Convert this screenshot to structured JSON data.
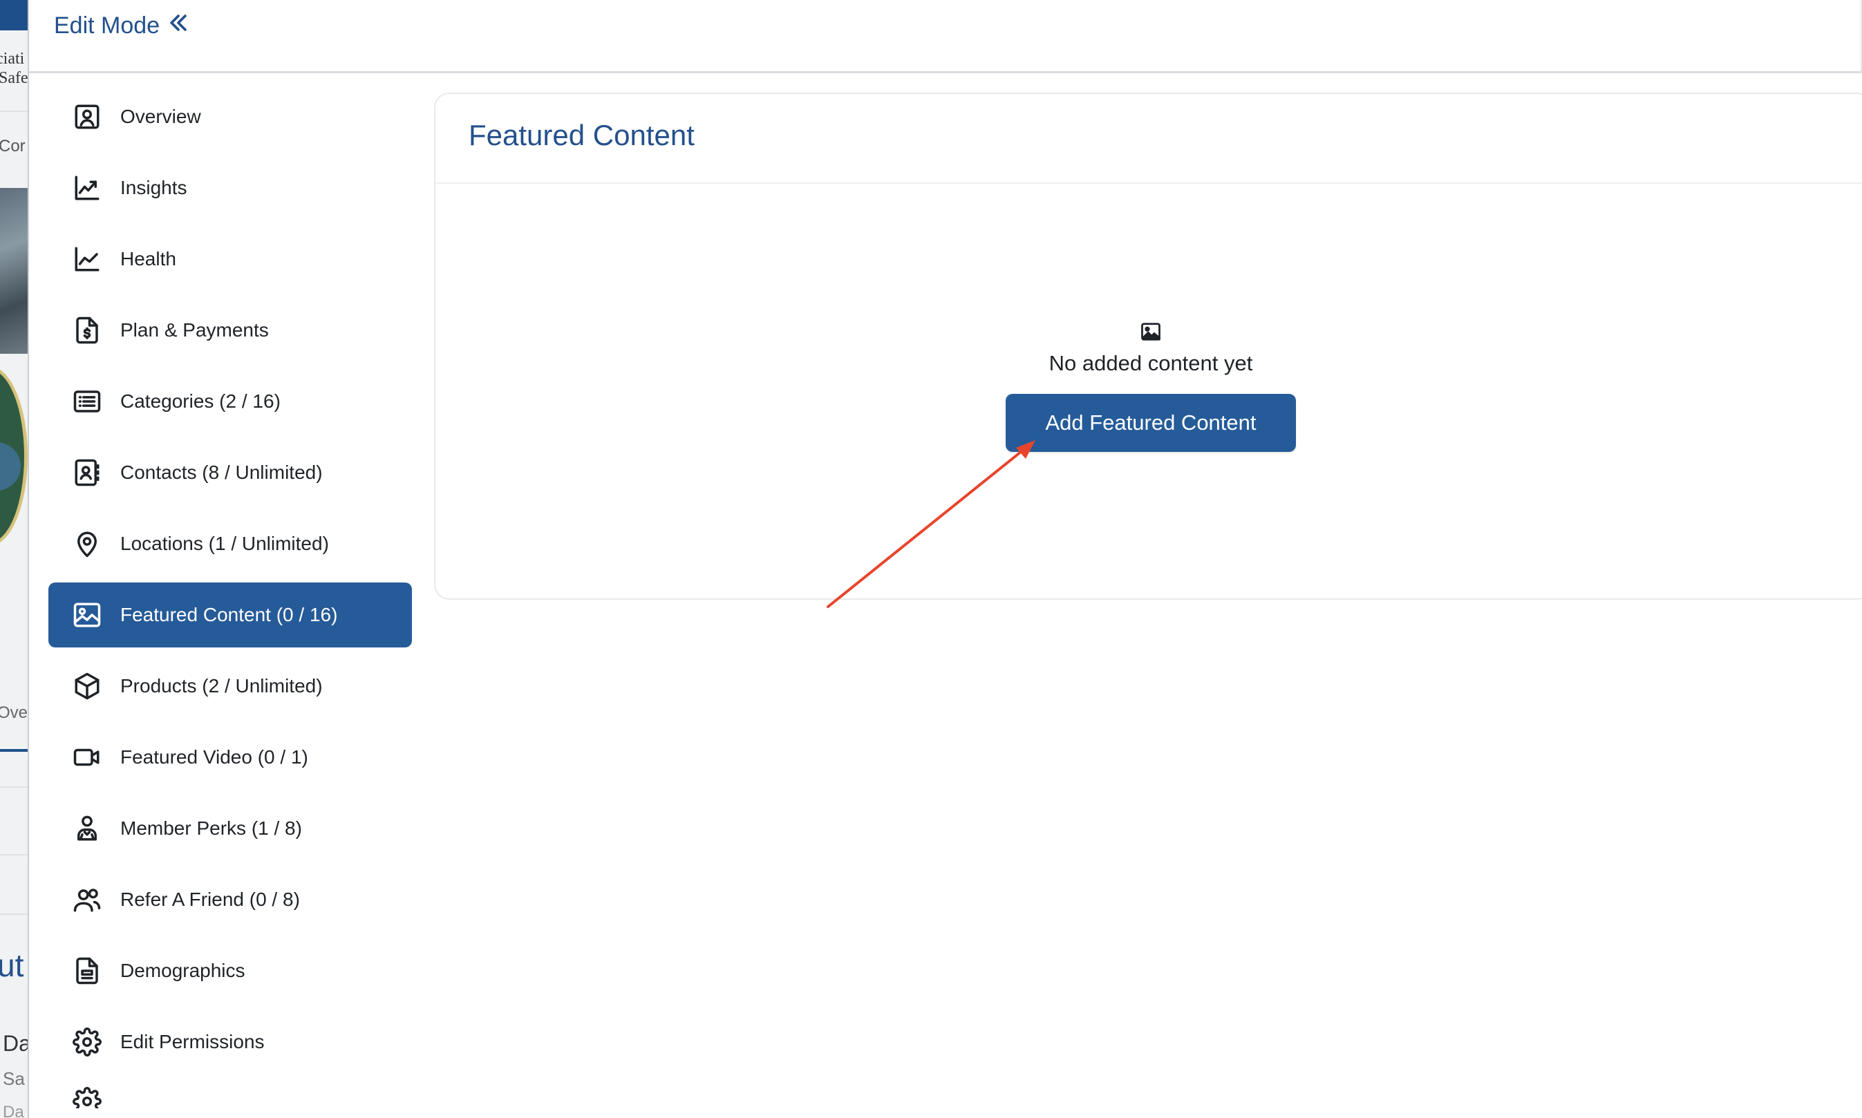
{
  "background": {
    "fragments": [
      "ciati",
      "Safe",
      "Cor",
      "Over",
      "ut",
      "Da",
      "Sa",
      "Da"
    ]
  },
  "header": {
    "title": "Edit Mode",
    "collapse_icon": "double-chevron-left-icon"
  },
  "sidebar": {
    "items": [
      {
        "label": "Overview",
        "icon": "user-square-icon",
        "active": false
      },
      {
        "label": "Insights",
        "icon": "trending-up-icon",
        "active": false
      },
      {
        "label": "Health",
        "icon": "line-chart-icon",
        "active": false
      },
      {
        "label": "Plan & Payments",
        "icon": "invoice-dollar-icon",
        "active": false
      },
      {
        "label": "Categories (2 / 16)",
        "icon": "list-icon",
        "active": false
      },
      {
        "label": "Contacts (8 / Unlimited)",
        "icon": "contact-book-icon",
        "active": false
      },
      {
        "label": "Locations (1 / Unlimited)",
        "icon": "map-pin-icon",
        "active": false
      },
      {
        "label": "Featured Content (0 / 16)",
        "icon": "image-icon",
        "active": true
      },
      {
        "label": "Products (2 / Unlimited)",
        "icon": "box-icon",
        "active": false
      },
      {
        "label": "Featured Video (0 / 1)",
        "icon": "video-camera-icon",
        "active": false
      },
      {
        "label": "Member Perks (1 / 8)",
        "icon": "member-badge-icon",
        "active": false
      },
      {
        "label": "Refer A Friend (0 / 8)",
        "icon": "users-icon",
        "active": false
      },
      {
        "label": "Demographics",
        "icon": "document-chart-icon",
        "active": false
      },
      {
        "label": "Edit Permissions",
        "icon": "gear-icon",
        "active": false
      },
      {
        "label": "",
        "icon": "gear-icon",
        "active": false
      }
    ]
  },
  "main": {
    "title": "Featured Content",
    "empty_state": {
      "icon": "image-icon",
      "message": "No added content yet",
      "button_label": "Add Featured Content"
    }
  },
  "colors": {
    "brand": "#265b99",
    "title": "#24508c",
    "annotation_arrow": "#e8452c"
  }
}
